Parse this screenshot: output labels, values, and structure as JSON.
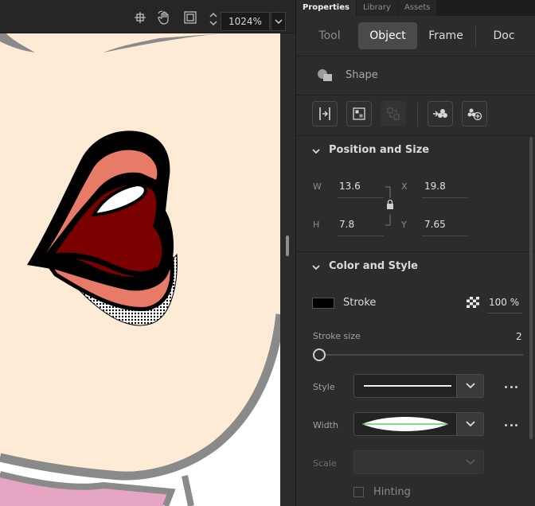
{
  "stage": {
    "toolbar": {
      "icons": [
        "crosshair-icon",
        "hand-rotate-icon",
        "clip-canvas-icon",
        "stepper-icon"
      ],
      "zoom_value": "1024%"
    }
  },
  "panel": {
    "tabs": [
      {
        "label": "Properties",
        "active": true
      },
      {
        "label": "Library",
        "active": false
      },
      {
        "label": "Assets",
        "active": false
      }
    ],
    "mode_tabs": [
      {
        "label": "Tool",
        "state": "dim"
      },
      {
        "label": "Object",
        "state": "active"
      },
      {
        "label": "Frame",
        "state": "normal"
      },
      {
        "label": "Doc",
        "state": "normal"
      }
    ],
    "object_type": "Shape",
    "position_size": {
      "title": "Position and Size",
      "w_label": "W",
      "w_value": "13.6",
      "h_label": "H",
      "h_value": "7.8",
      "x_label": "X",
      "x_value": "19.8",
      "y_label": "Y",
      "y_value": "7.65"
    },
    "color_style": {
      "title": "Color and Style",
      "stroke_label": "Stroke",
      "stroke_color": "#000000",
      "alpha_value": "100 %",
      "stroke_size_label": "Stroke size",
      "stroke_size_value": "2",
      "style_label": "Style",
      "width_label": "Width",
      "scale_label": "Scale",
      "hinting_label": "Hinting"
    }
  },
  "colors": {
    "skin": "#fdebd6",
    "lip_dark": "#7b0000",
    "lip_light": "#e87a68",
    "outline": "#8a8a8a"
  }
}
